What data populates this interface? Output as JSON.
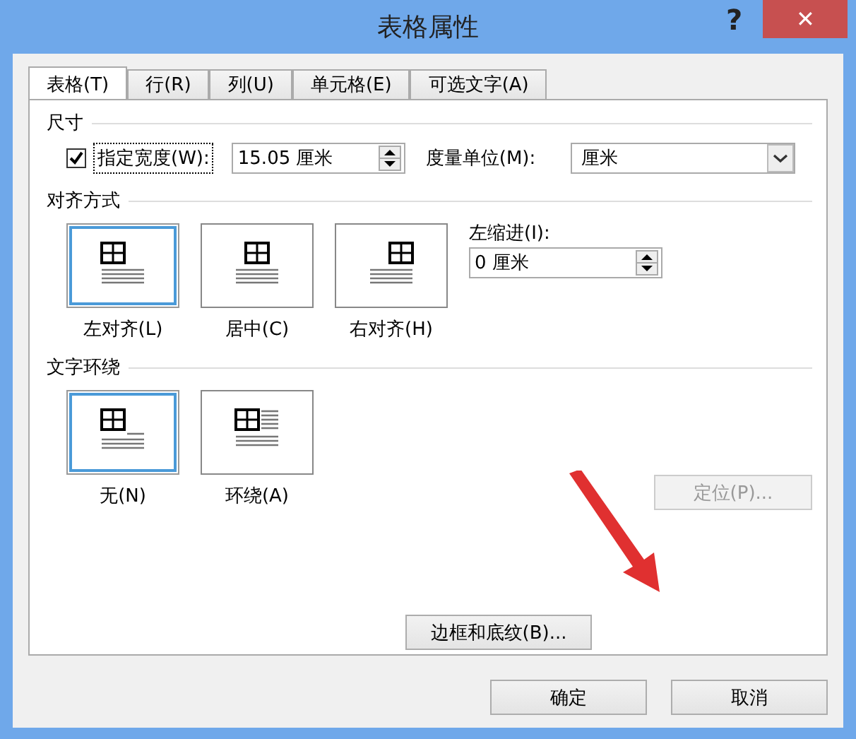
{
  "window": {
    "title": "表格属性",
    "help": "?",
    "close": "✕"
  },
  "tabs": [
    {
      "label": "表格(T)",
      "selected": true
    },
    {
      "label": "行(R)",
      "selected": false
    },
    {
      "label": "列(U)",
      "selected": false
    },
    {
      "label": "单元格(E)",
      "selected": false
    },
    {
      "label": "可选文字(A)",
      "selected": false
    }
  ],
  "size": {
    "heading": "尺寸",
    "width_check": {
      "label": "指定宽度(W):",
      "checked": true
    },
    "width_value": "15.05 厘米",
    "unit_label": "度量单位(M):",
    "unit_value": "厘米"
  },
  "alignment": {
    "heading": "对齐方式",
    "options": [
      {
        "kind": "left",
        "label": "左对齐(L)",
        "selected": true
      },
      {
        "kind": "center",
        "label": "居中(C)",
        "selected": false
      },
      {
        "kind": "right",
        "label": "右对齐(H)",
        "selected": false
      }
    ],
    "indent_label": "左缩进(I):",
    "indent_value": "0 厘米"
  },
  "wrapping": {
    "heading": "文字环绕",
    "options": [
      {
        "kind": "none",
        "label": "无(N)",
        "selected": true
      },
      {
        "kind": "around",
        "label": "环绕(A)",
        "selected": false
      }
    ],
    "position_button": {
      "label": "定位(P)...",
      "disabled": true
    }
  },
  "panel_buttons": [
    {
      "label": "边框和底纹(B)...",
      "disabled": false
    }
  ],
  "buttons": [
    {
      "label": "确定"
    },
    {
      "label": "取消"
    }
  ]
}
